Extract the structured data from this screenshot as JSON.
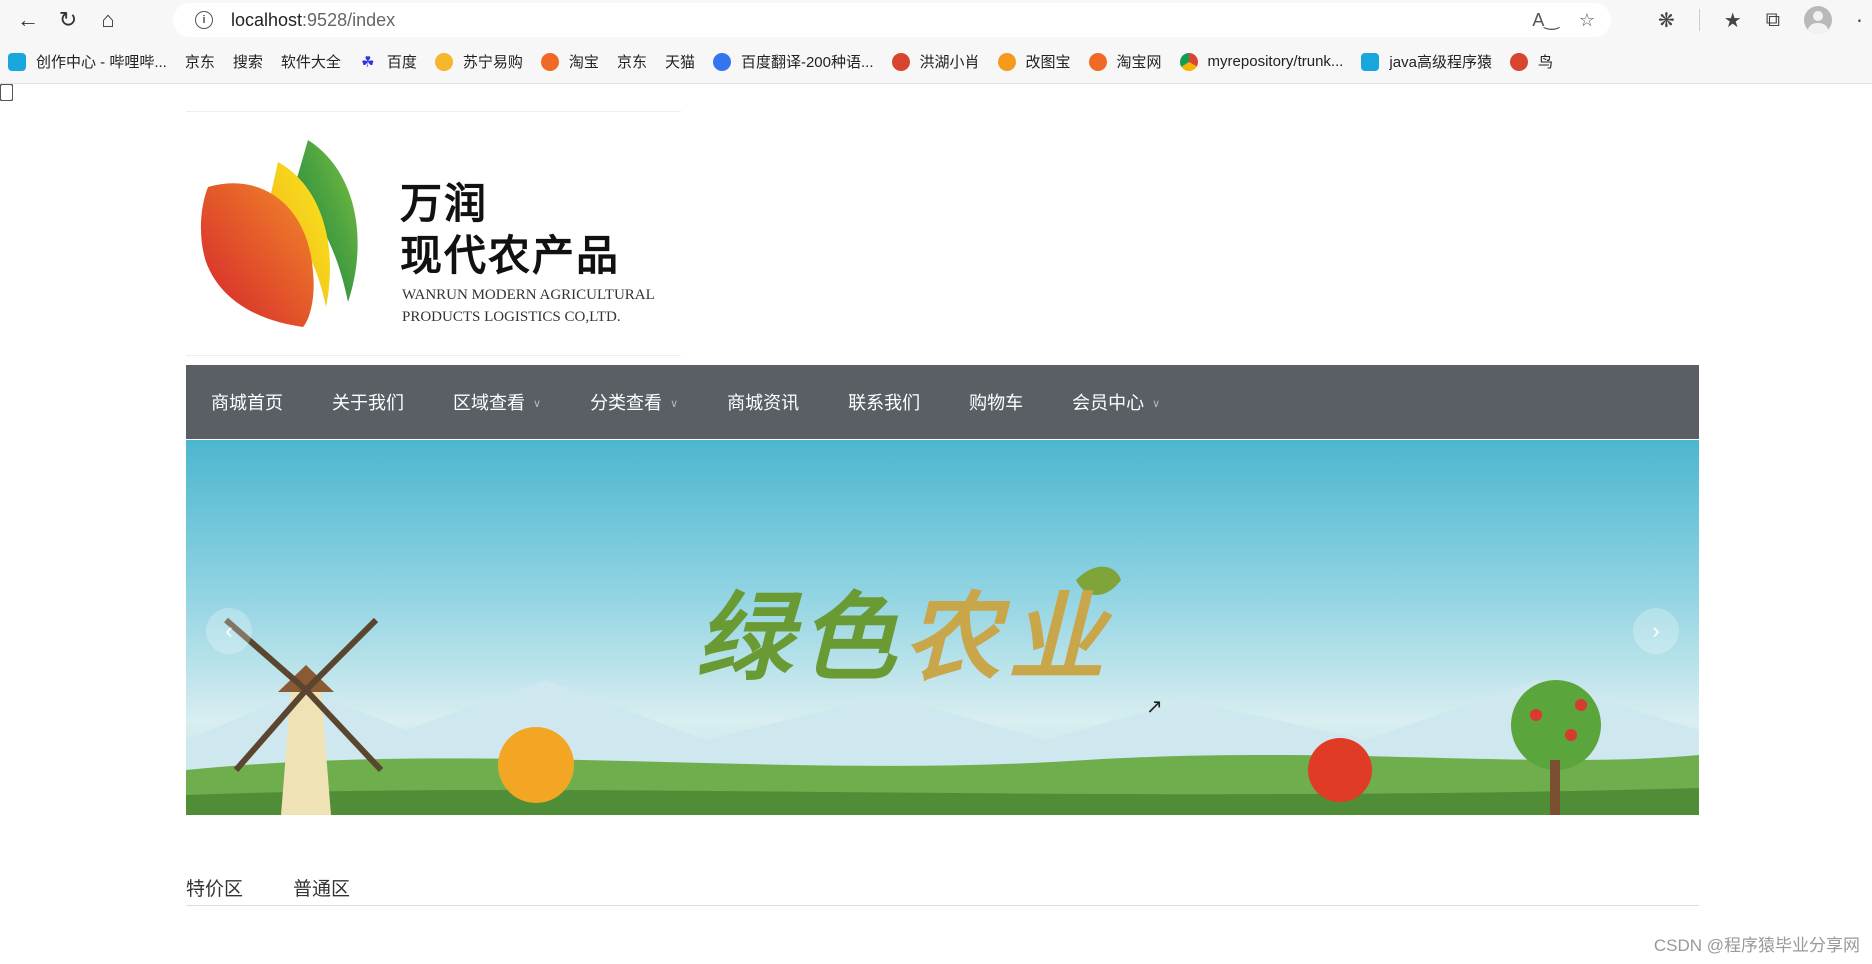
{
  "browser": {
    "url_host": "localhost",
    "url_rest": ":9528/index",
    "bookmarks": [
      {
        "label": "创作中心 - 哔哩哔...",
        "icon": "bili-icon"
      },
      {
        "label": "京东",
        "icon": "page-icon"
      },
      {
        "label": "搜索",
        "icon": "page-icon"
      },
      {
        "label": "软件大全",
        "icon": "page-icon"
      },
      {
        "label": "百度",
        "icon": "baidu-icon"
      },
      {
        "label": "苏宁易购",
        "icon": "suning-icon"
      },
      {
        "label": "淘宝",
        "icon": "taobao-icon"
      },
      {
        "label": "京东",
        "icon": "page-icon"
      },
      {
        "label": "天猫",
        "icon": "page-icon"
      },
      {
        "label": "百度翻译-200种语...",
        "icon": "translate-icon"
      },
      {
        "label": "洪湖小肖",
        "icon": "bird-icon"
      },
      {
        "label": "改图宝",
        "icon": "gaitu-icon"
      },
      {
        "label": "淘宝网",
        "icon": "taobao-icon"
      },
      {
        "label": "myrepository/trunk...",
        "icon": "chrome-icon"
      },
      {
        "label": "java高级程序猿",
        "icon": "bili-icon"
      },
      {
        "label": "鸟",
        "icon": "bird-icon"
      }
    ]
  },
  "logo": {
    "cn_line1": "万润",
    "cn_line2": "现代农产品",
    "en_line1": "WANRUN MODERN AGRICULTURAL",
    "en_line2": "PRODUCTS  LOGISTICS CO,LTD."
  },
  "nav": {
    "items": [
      {
        "label": "商城首页",
        "dropdown": false
      },
      {
        "label": "关于我们",
        "dropdown": false
      },
      {
        "label": "区域查看",
        "dropdown": true
      },
      {
        "label": "分类查看",
        "dropdown": true
      },
      {
        "label": "商城资讯",
        "dropdown": false
      },
      {
        "label": "联系我们",
        "dropdown": false
      },
      {
        "label": "购物车",
        "dropdown": false
      },
      {
        "label": "会员中心",
        "dropdown": true
      }
    ]
  },
  "banner": {
    "title_a": "绿色",
    "title_b": "农业",
    "prev": "‹",
    "next": "›"
  },
  "tabs": [
    "特价区",
    "普通区"
  ],
  "watermark": "CSDN @程序猿毕业分享网",
  "colors": {
    "nav_bg": "#5a5f66",
    "chrome_bg": "#f7f7f7"
  }
}
